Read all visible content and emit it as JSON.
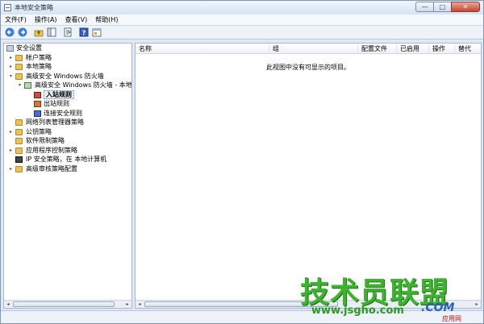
{
  "window": {
    "title": "本地安全策略"
  },
  "window_buttons": {
    "minimize": "—",
    "maximize": "□",
    "close": "✕"
  },
  "menu": [
    "文件(F)",
    "操作(A)",
    "查看(V)",
    "帮助(H)"
  ],
  "toolbar_icons": [
    "back-arrow-icon",
    "forward-arrow-icon",
    "up-folder-icon",
    "show-hide-tree-icon",
    "export-list-icon",
    "help-icon",
    "properties-icon"
  ],
  "tree": [
    {
      "label": "安全设置",
      "level": 0,
      "expander": "",
      "icon": "root"
    },
    {
      "label": "帐户策略",
      "level": 1,
      "expander": "▸",
      "icon": "folder"
    },
    {
      "label": "本地策略",
      "level": 1,
      "expander": "▸",
      "icon": "folder"
    },
    {
      "label": "高级安全 Windows 防火墙",
      "level": 1,
      "expander": "▾",
      "icon": "folder"
    },
    {
      "label": "高级安全 Windows 防火墙 - 本地i",
      "level": 2,
      "expander": "▾",
      "icon": "firewall"
    },
    {
      "label": "入站规则",
      "level": 3,
      "expander": "",
      "icon": "inbound",
      "selected": true
    },
    {
      "label": "出站规则",
      "level": 3,
      "expander": "",
      "icon": "outbound"
    },
    {
      "label": "连接安全规则",
      "level": 3,
      "expander": "",
      "icon": "connection"
    },
    {
      "label": "网络列表管理器策略",
      "level": 1,
      "expander": "",
      "icon": "folder"
    },
    {
      "label": "公钥策略",
      "level": 1,
      "expander": "▸",
      "icon": "folder"
    },
    {
      "label": "软件限制策略",
      "level": 1,
      "expander": "",
      "icon": "folder"
    },
    {
      "label": "应用程序控制策略",
      "level": 1,
      "expander": "▸",
      "icon": "folder"
    },
    {
      "label": "IP 安全策略，在 本地计算机",
      "level": 1,
      "expander": "",
      "icon": "ip"
    },
    {
      "label": "高级审核策略配置",
      "level": 1,
      "expander": "▸",
      "icon": "folder"
    }
  ],
  "list": {
    "columns": [
      "名称",
      "组",
      "配置文件",
      "已启用",
      "操作",
      "替代"
    ],
    "empty_message": "此视图中没有可显示的项目。"
  },
  "scrollbar": {
    "left_arrow": "◂",
    "right_arrow": "▸"
  },
  "watermark": {
    "brand": "技术员联盟",
    "url": "www.jsgho.com",
    "com": ".COM",
    "tag": "应用网"
  },
  "colors": {
    "watermark_green": "#3cb42d",
    "accent_blue": "#2a5fc4"
  }
}
